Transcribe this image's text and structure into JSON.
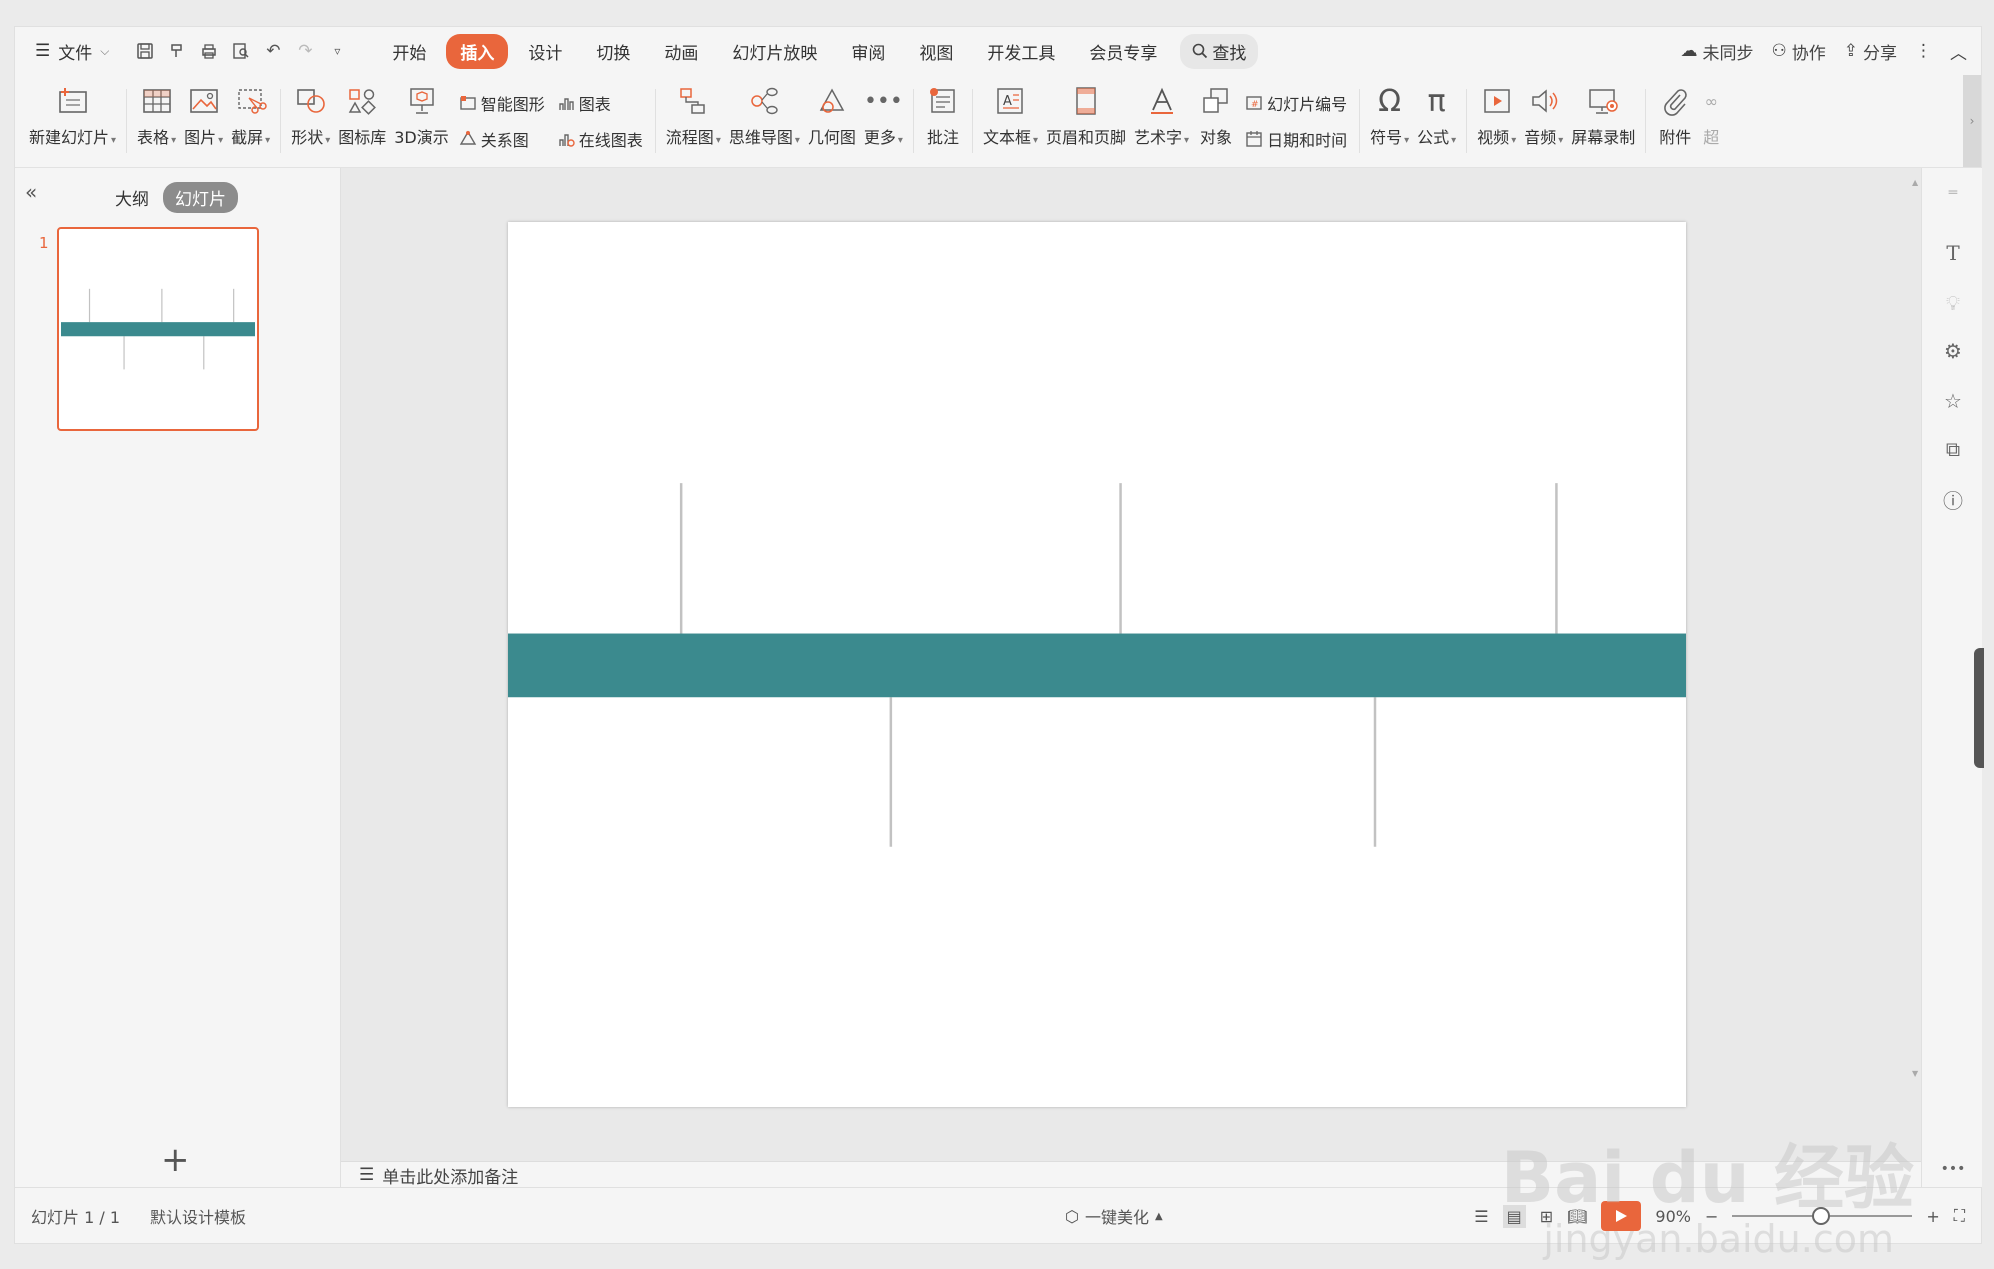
{
  "menubar": {
    "file": "文件",
    "tabs": [
      "开始",
      "插入",
      "设计",
      "切换",
      "动画",
      "幻灯片放映",
      "审阅",
      "视图",
      "开发工具",
      "会员专享"
    ],
    "active_tab": "插入",
    "search": "查找",
    "right": {
      "sync": "未同步",
      "collab": "协作",
      "share": "分享"
    }
  },
  "ribbon": {
    "new_slide": "新建幻灯片",
    "table": "表格",
    "picture": "图片",
    "screenshot": "截屏",
    "shape": "形状",
    "icon_lib": "图标库",
    "demo3d": "3D演示",
    "smart_graphic": "智能图形",
    "relation": "关系图",
    "chart": "图表",
    "online_chart": "在线图表",
    "flowchart": "流程图",
    "mindmap": "思维导图",
    "geometry": "几何图",
    "more": "更多",
    "comment": "批注",
    "textbox": "文本框",
    "header_footer": "页眉和页脚",
    "wordart": "艺术字",
    "object": "对象",
    "slide_number": "幻灯片编号",
    "datetime": "日期和时间",
    "symbol": "符号",
    "formula": "公式",
    "video": "视频",
    "audio": "音频",
    "screen_record": "屏幕录制",
    "attachment": "附件",
    "overflow": "超"
  },
  "leftpanel": {
    "outline_tab": "大纲",
    "slides_tab": "幻灯片",
    "slide_number": "1"
  },
  "slide": {
    "accent_color": "#3b8a8e",
    "line_color": "#c2c2c2"
  },
  "notes": {
    "placeholder": "单击此处添加备注"
  },
  "statusbar": {
    "slide_info": "幻灯片 1 / 1",
    "template": "默认设计模板",
    "beautify": "一键美化",
    "zoom": "90%"
  },
  "watermark": {
    "main": "Bai du 经验",
    "sub": "jingyan.baidu.com"
  }
}
